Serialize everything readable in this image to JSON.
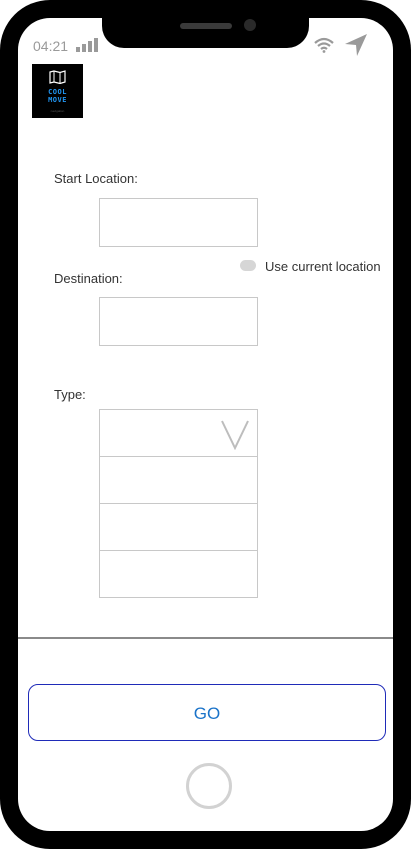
{
  "status_bar": {
    "time": "04:21"
  },
  "logo": {
    "word1": "COOL",
    "word2": "MOVE",
    "tagline": "navigation"
  },
  "form": {
    "start_label": "Start Location:",
    "start_value": "",
    "destination_label": "Destination:",
    "destination_value": "",
    "current_location_label": "Use current location",
    "type_label": "Type:",
    "type_options": [
      "",
      "",
      "",
      ""
    ]
  },
  "go_button": {
    "label": "GO"
  },
  "icons": [
    "signal-icon",
    "wifi-icon",
    "navigation-arrow-icon",
    "map-icon",
    "chevron-down-icon"
  ]
}
